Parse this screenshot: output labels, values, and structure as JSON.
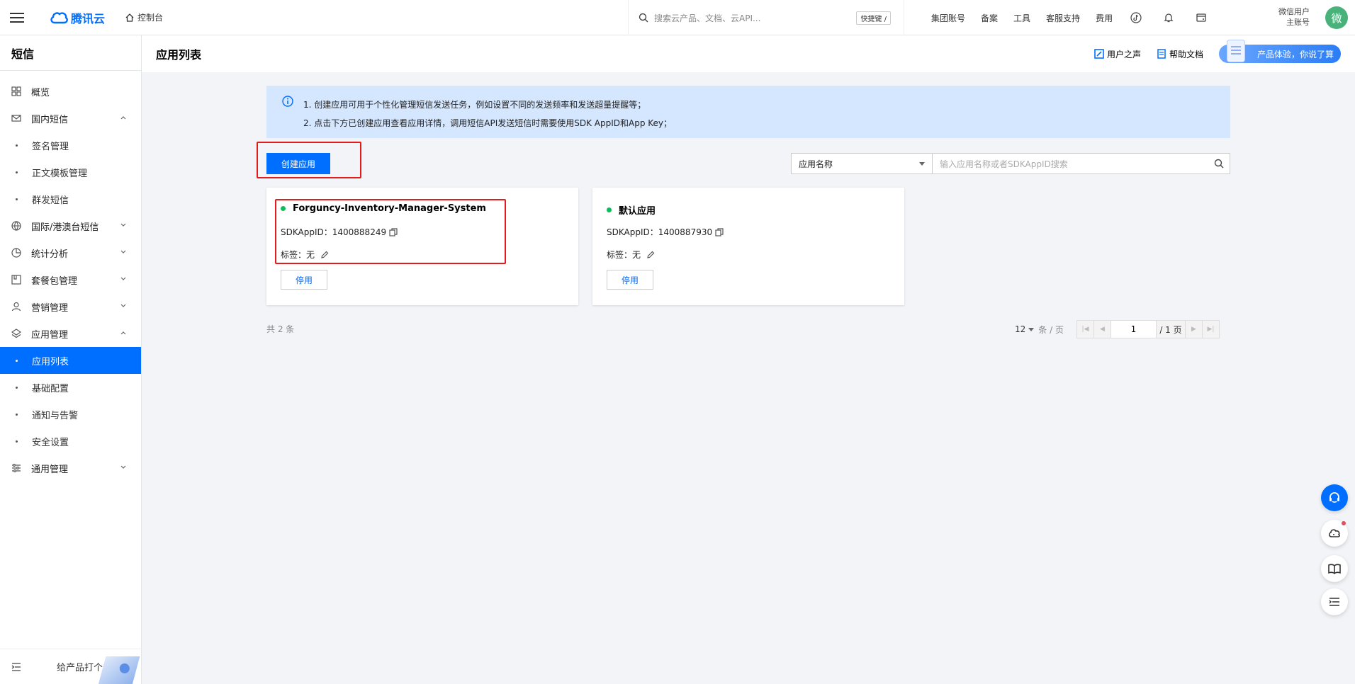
{
  "topbar": {
    "logo_text": "腾讯云",
    "console_label": "控制台",
    "search_placeholder": "搜索云产品、文档、云API...",
    "shortcut_label": "快捷键 /",
    "nav": [
      "集团账号",
      "备案",
      "工具",
      "客服支持",
      "费用"
    ],
    "user_name": "微信用户",
    "user_role": "主账号",
    "avatar_char": "微"
  },
  "sidebar": {
    "title": "短信",
    "items": [
      {
        "label": "概览",
        "icon": "grid-icon",
        "type": "top"
      },
      {
        "label": "国内短信",
        "icon": "mail-icon",
        "type": "group",
        "expanded": true
      },
      {
        "label": "签名管理",
        "type": "sub"
      },
      {
        "label": "正文模板管理",
        "type": "sub"
      },
      {
        "label": "群发短信",
        "type": "sub"
      },
      {
        "label": "国际/港澳台短信",
        "icon": "globe-icon",
        "type": "group",
        "expanded": false
      },
      {
        "label": "统计分析",
        "icon": "chart-icon",
        "type": "group",
        "expanded": false
      },
      {
        "label": "套餐包管理",
        "icon": "package-icon",
        "type": "group",
        "expanded": false
      },
      {
        "label": "营销管理",
        "icon": "user-icon",
        "type": "group",
        "expanded": false
      },
      {
        "label": "应用管理",
        "icon": "layers-icon",
        "type": "group",
        "expanded": true
      },
      {
        "label": "应用列表",
        "type": "sub",
        "active": true
      },
      {
        "label": "基础配置",
        "type": "sub"
      },
      {
        "label": "通知与告警",
        "type": "sub"
      },
      {
        "label": "安全设置",
        "type": "sub"
      },
      {
        "label": "通用管理",
        "icon": "sliders-icon",
        "type": "group",
        "expanded": false
      }
    ],
    "footer_label": "给产品打个分"
  },
  "page": {
    "title": "应用列表",
    "user_voice": "用户之声",
    "help_docs": "帮助文档",
    "promo": "产品体验，你说了算"
  },
  "notice": {
    "line1": "1. 创建应用可用于个性化管理短信发送任务，例如设置不同的发送频率和发送超量提醒等；",
    "line2": "2. 点击下方已创建应用查看应用详情，调用短信API发送短信时需要使用SDK AppID和App Key；"
  },
  "actions": {
    "create_label": "创建应用",
    "filter_select": "应用名称",
    "filter_placeholder": "输入应用名称或者SDKAppID搜索"
  },
  "apps": [
    {
      "name": "Forguncy-Inventory-Manager-System",
      "sdk_label": "SDKAppID：",
      "sdk_id": "1400888249",
      "tag_label": "标签：",
      "tag_value": "无",
      "button": "停用"
    },
    {
      "name": "默认应用",
      "sdk_label": "SDKAppID：",
      "sdk_id": "1400887930",
      "tag_label": "标签：",
      "tag_value": "无",
      "button": "停用"
    }
  ],
  "pagination": {
    "total": "共 2 条",
    "page_size": "12",
    "per_page": "条 / 页",
    "current": "1",
    "total_pages": "/ 1 页"
  },
  "colors": {
    "primary": "#006eff",
    "status_green": "#0abf5b",
    "highlight_red": "#e31b1b"
  }
}
